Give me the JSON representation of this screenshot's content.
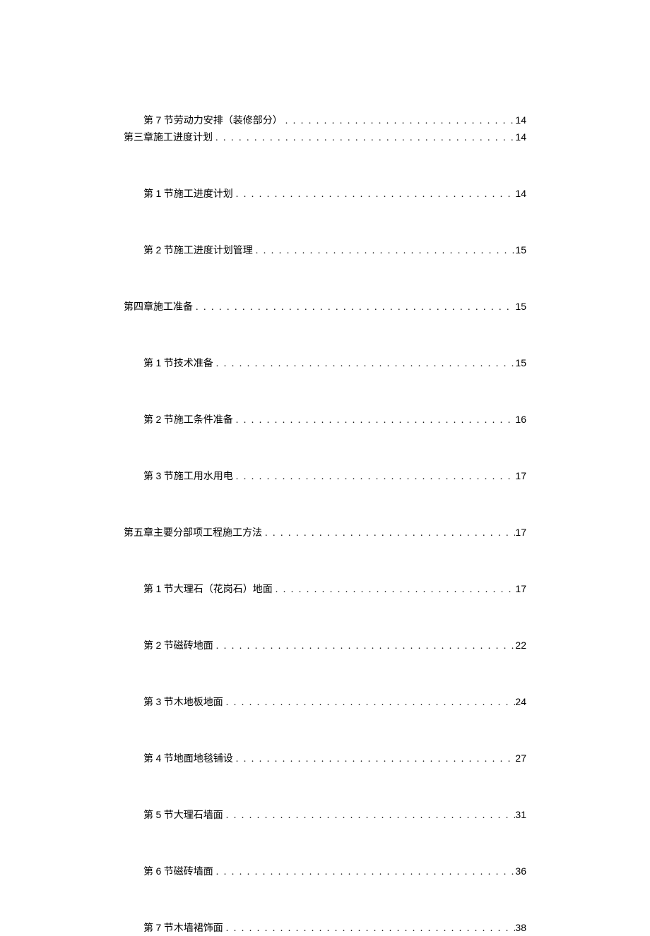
{
  "toc": [
    {
      "level": "section",
      "num": "7",
      "prefix": "第 ",
      "suffix": " 节劳动力安排（装修部分）",
      "page": "14",
      "tight": true
    },
    {
      "level": "chapter",
      "text": "第三章施工进度计划",
      "page": "14"
    },
    {
      "level": "section",
      "num": "1",
      "prefix": "第 ",
      "suffix": " 节施工进度计划",
      "page": "14"
    },
    {
      "level": "section",
      "num": "2",
      "prefix": "第 ",
      "suffix": " 节施工进度计划管理",
      "page": "15"
    },
    {
      "level": "chapter",
      "text": "第四章施工准备",
      "page": "15"
    },
    {
      "level": "section",
      "num": "1",
      "prefix": "第 ",
      "suffix": " 节技术准备",
      "page": "15"
    },
    {
      "level": "section",
      "num": "2",
      "prefix": "第 ",
      "suffix": " 节施工条件准备",
      "page": "16"
    },
    {
      "level": "section",
      "num": "3",
      "prefix": "第 ",
      "suffix": " 节施工用水用电",
      "page": "17"
    },
    {
      "level": "chapter",
      "text": "第五章主要分部项工程施工方法",
      "page": "17"
    },
    {
      "level": "section",
      "num": "1",
      "prefix": "第 ",
      "suffix": " 节大理石（花岗石）地面",
      "page": "17"
    },
    {
      "level": "section",
      "num": "2",
      "prefix": "第 ",
      "suffix": " 节磁砖地面",
      "page": "22"
    },
    {
      "level": "section",
      "num": "3",
      "prefix": "第 ",
      "suffix": " 节木地板地面",
      "page": "24"
    },
    {
      "level": "section",
      "num": "4",
      "prefix": "第 ",
      "suffix": " 节地面地毯铺设",
      "page": "27"
    },
    {
      "level": "section",
      "num": "5",
      "prefix": "第 ",
      "suffix": " 节大理石墙面",
      "page": "31"
    },
    {
      "level": "section",
      "num": "6",
      "prefix": "第 ",
      "suffix": " 节磁砖墙面",
      "page": "36"
    },
    {
      "level": "section",
      "num": "7",
      "prefix": "第 ",
      "suffix": " 节木墙裙饰面",
      "page": "38"
    }
  ]
}
